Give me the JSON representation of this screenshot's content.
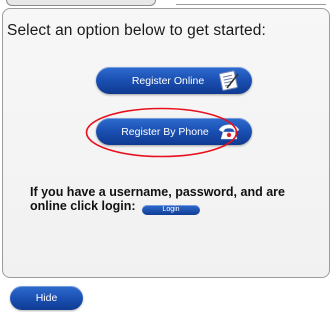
{
  "heading": "Select an option below to get started:",
  "buttons": {
    "register_online": "Register Online",
    "register_phone": "Register By Phone"
  },
  "icons": {
    "register_online": "notepad-pencil-icon",
    "register_phone": "telephone-icon"
  },
  "login": {
    "prompt": "If you have a username, password, and are online click login:",
    "button": "Login"
  },
  "footer": {
    "hide": "Hide"
  },
  "colors": {
    "button_blue": "#1a4fb1",
    "highlight_red": "#e8101c"
  }
}
